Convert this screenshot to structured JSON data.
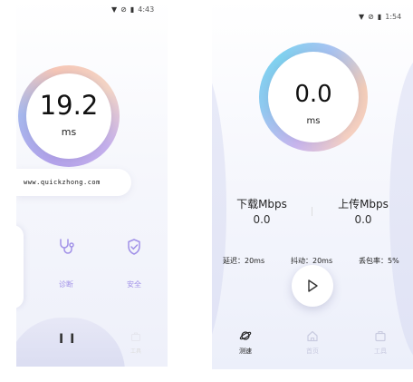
{
  "left_screen": {
    "status_bar": {
      "icons": [
        "wifi-icon",
        "no-sim-icon",
        "battery-icon"
      ],
      "time": "4:43"
    },
    "gauge": {
      "value": "19.2",
      "unit": "ms"
    },
    "url": "www.quickzhong.com",
    "features": [
      {
        "icon": "stethoscope-icon",
        "label": "诊断"
      },
      {
        "icon": "shield-check-icon",
        "label": "安全"
      }
    ],
    "tools_label": "工具"
  },
  "right_screen": {
    "status_bar": {
      "icons": [
        "wifi-icon",
        "no-sim-icon",
        "battery-icon"
      ],
      "time": "1:54"
    },
    "gauge": {
      "value": "0.0",
      "unit": "ms"
    },
    "download": {
      "title": "下载Mbps",
      "value": "0.0"
    },
    "upload": {
      "title": "上传Mbps",
      "value": "0.0"
    },
    "metrics": {
      "latency": "延迟：20ms",
      "jitter": "抖动：20ms",
      "packet_loss": "丢包率：5%"
    },
    "nav": [
      {
        "icon": "planet-icon",
        "label": "测速",
        "active": true
      },
      {
        "icon": "home-icon",
        "label": "首页",
        "active": false
      },
      {
        "icon": "toolbox-icon",
        "label": "工具",
        "active": false
      }
    ]
  },
  "colors": {
    "accent_purple": "#a191e8",
    "inactive_nav": "#c9cbe0",
    "active_nav": "#222222"
  }
}
